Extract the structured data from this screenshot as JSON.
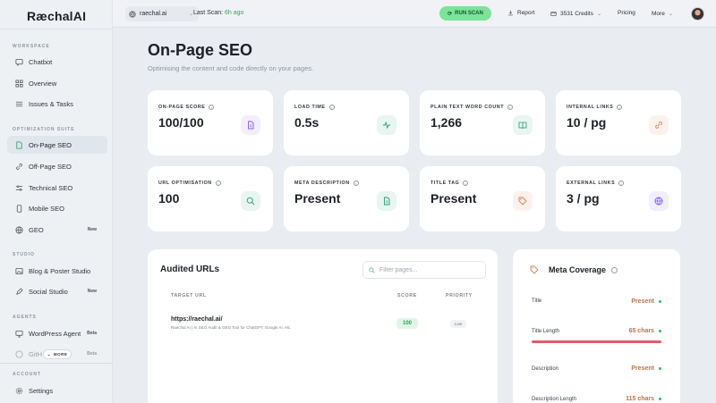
{
  "app": {
    "logo": "RæchalAI"
  },
  "sidebar": {
    "sections": {
      "workspace": "WORKSPACE",
      "optimization": "OPTIMIZATION SUITE",
      "studio": "STUDIO",
      "agents": "AGENTS",
      "account": "ACCOUNT"
    },
    "items": {
      "chatbot": "Chatbot",
      "overview": "Overview",
      "issues": "Issues & Tasks",
      "onpage": "On-Page SEO",
      "offpage": "Off-Page SEO",
      "technical": "Technical SEO",
      "mobile": "Mobile SEO",
      "geo": "GEO",
      "blog": "Blog & Poster Studio",
      "social": "Social Studio",
      "wordpress": "WordPress Agent",
      "github": "GitH",
      "settings": "Settings"
    },
    "badges": {
      "geo": "New",
      "social": "New",
      "wordpress": "Beta",
      "github": "Beta"
    },
    "more_label": "MORE"
  },
  "topbar": {
    "project": "raechal.ai",
    "last_scan_label": "Last Scan:",
    "last_scan_time": "6h ago",
    "run_scan": "RUN SCAN",
    "report": "Report",
    "credits": "3531 Credits",
    "pricing": "Pricing",
    "more": "More"
  },
  "page": {
    "title": "On-Page SEO",
    "subtitle": "Optimising the content and code directly on your pages."
  },
  "metrics": [
    {
      "label": "ON-PAGE SCORE",
      "value": "100/100",
      "icon": "document-icon",
      "color": "#8b5cf6"
    },
    {
      "label": "LOAD TIME",
      "value": "0.5s",
      "icon": "activity-icon",
      "color": "#22a06b"
    },
    {
      "label": "PLAIN TEXT WORD COUNT",
      "value": "1,266",
      "icon": "book-icon",
      "color": "#1f9d74"
    },
    {
      "label": "INTERNAL LINKS",
      "value": "10 / pg",
      "icon": "link-icon",
      "color": "#e07b4f"
    },
    {
      "label": "URL OPTIMISATION",
      "value": "100",
      "icon": "search-icon",
      "color": "#1f9d74"
    },
    {
      "label": "META DESCRIPTION",
      "value": "Present",
      "icon": "document-icon",
      "color": "#22a06b"
    },
    {
      "label": "TITLE TAG",
      "value": "Present",
      "icon": "tag-icon",
      "color": "#e07b4f"
    },
    {
      "label": "EXTERNAL LINKS",
      "value": "3 / pg",
      "icon": "globe-icon",
      "color": "#7c5cf0"
    }
  ],
  "audited": {
    "title": "Audited URLs",
    "filter_placeholder": "Filter pages...",
    "columns": {
      "url": "TARGET URL",
      "score": "SCORE",
      "priority": "PRIORITY"
    },
    "rows": [
      {
        "url": "https://raechal.ai/",
        "desc": "Raechal AI | AI SEO Audit & GEO Tool for ChatGPT, Google AI, etc.",
        "score": "100",
        "priority": "Low"
      }
    ]
  },
  "meta_coverage": {
    "title": "Meta Coverage",
    "rows": [
      {
        "label": "Title",
        "value": "Present"
      },
      {
        "label": "Title Length",
        "value": "65 chars"
      },
      {
        "label": "Description",
        "value": "Present"
      },
      {
        "label": "Description Length",
        "value": "115 chars"
      }
    ]
  }
}
